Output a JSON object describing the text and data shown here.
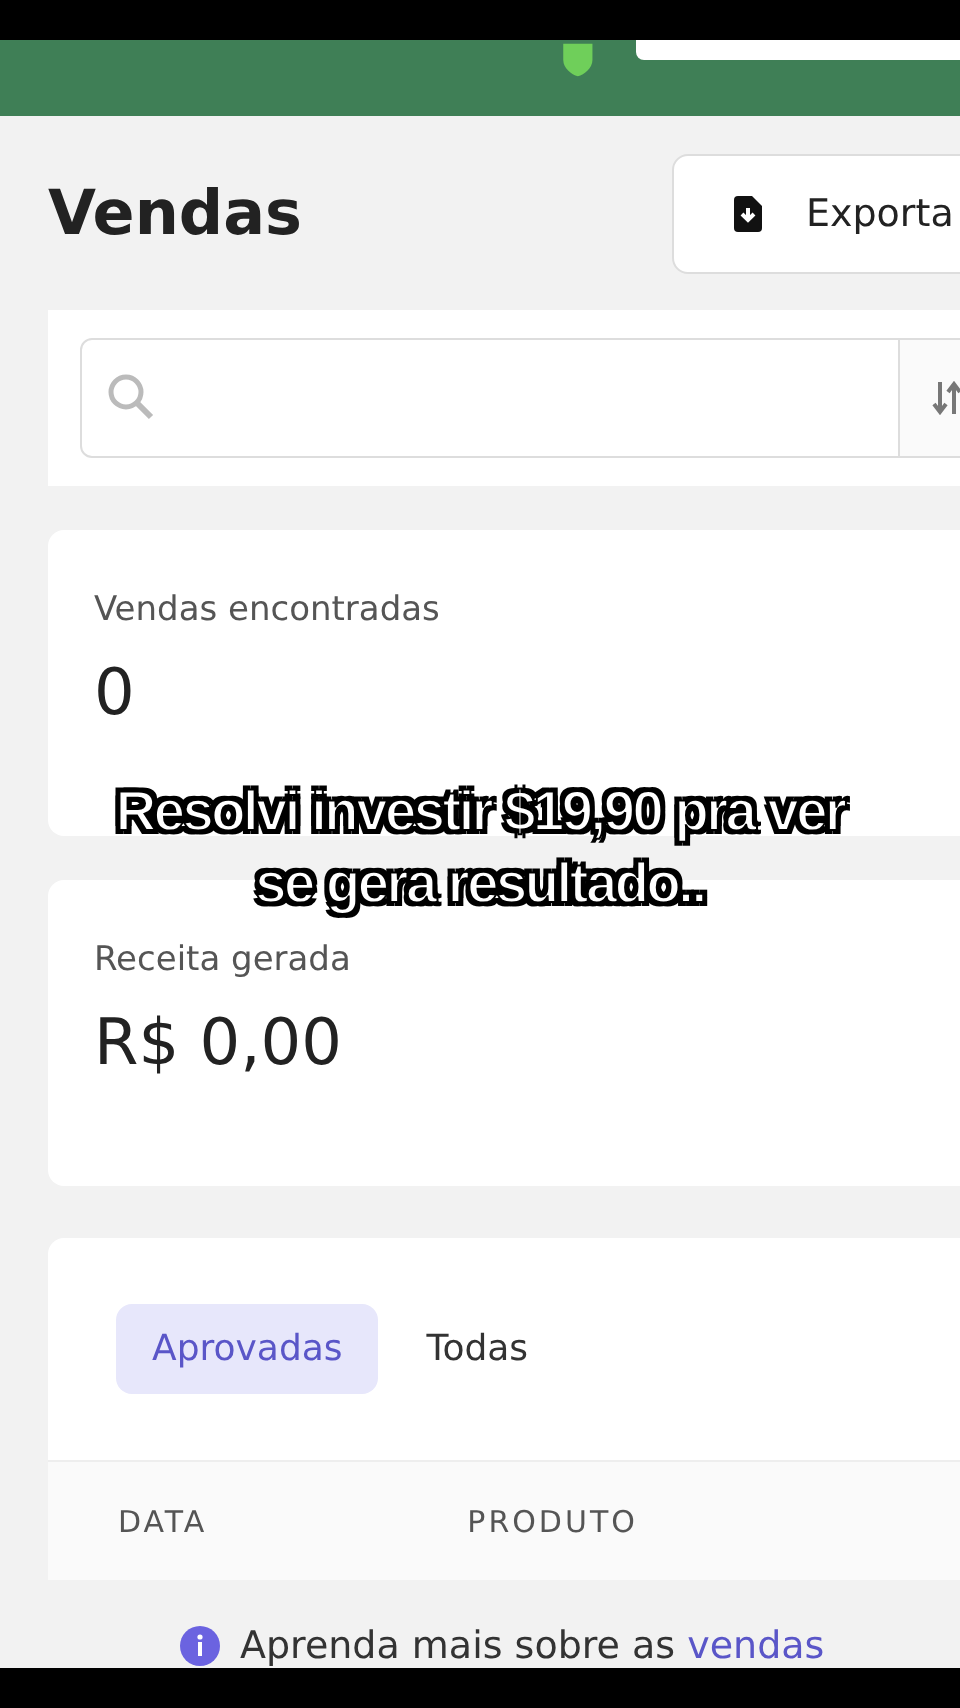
{
  "page": {
    "title": "Vendas",
    "export_button": "Exporta"
  },
  "stats": [
    {
      "label": "Vendas encontradas",
      "value": "0"
    },
    {
      "label": "Receita gerada",
      "value": "R$ 0,00"
    }
  ],
  "tabs": [
    {
      "label": "Aprovadas",
      "selected": true
    },
    {
      "label": "Todas",
      "selected": false
    }
  ],
  "table": {
    "columns": [
      "DATA",
      "PRODUTO"
    ]
  },
  "help": {
    "text": "Aprenda mais sobre as ",
    "link": "vendas"
  },
  "caption": [
    "Resolvi investir $19,90 pra ver",
    "se gera resultado.."
  ]
}
